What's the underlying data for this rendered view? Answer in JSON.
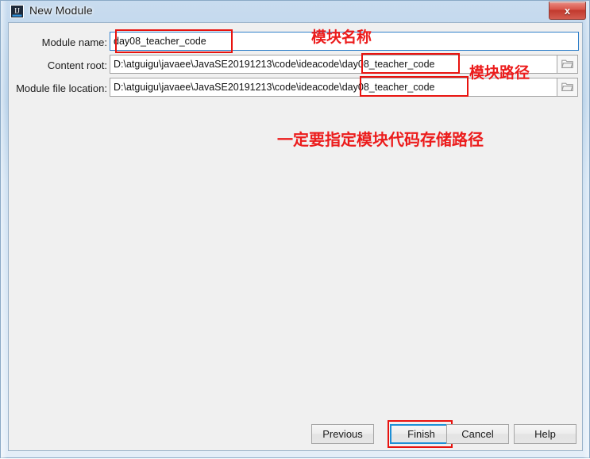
{
  "window": {
    "title": "New Module",
    "icon": "intellij-idea-icon",
    "close_label": "x",
    "accent_blue": "#2f7fc9",
    "annotation_red": "#ec1c1c",
    "client_background": "#f0f0f0"
  },
  "form": {
    "fields": [
      {
        "label": "Module name:",
        "value": "day08_teacher_code",
        "has_browse": false
      },
      {
        "label": "Content root:",
        "value": "D:\\atguigu\\javaee\\JavaSE20191213\\code\\ideacode\\day08_teacher_code",
        "has_browse": true,
        "browse_icon": "folder-icon"
      },
      {
        "label": "Module file location:",
        "value": "D:\\atguigu\\javaee\\JavaSE20191213\\code\\ideacode\\day08_teacher_code",
        "has_browse": true,
        "browse_icon": "folder-icon"
      }
    ]
  },
  "annotations": [
    {
      "id": "module-name",
      "text": "模块名称"
    },
    {
      "id": "module-path",
      "text": "模块路径"
    },
    {
      "id": "note",
      "text": "一定要指定模块代码存储路径"
    }
  ],
  "buttons": {
    "previous": "Previous",
    "finish": "Finish",
    "cancel": "Cancel",
    "help": "Help"
  }
}
